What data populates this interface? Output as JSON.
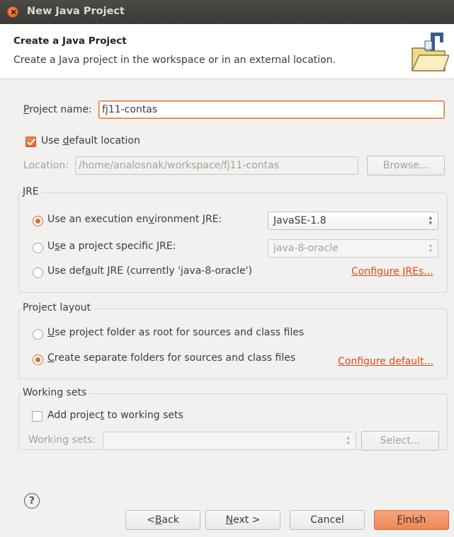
{
  "window": {
    "title": "New Java Project"
  },
  "header": {
    "title": "Create a Java Project",
    "description": "Create a Java project in the workspace or in an external location."
  },
  "project_name": {
    "label_prefix": "",
    "label_mnemonic": "P",
    "label_rest": "roject name:",
    "value": "fj11-contas"
  },
  "default_location": {
    "label_prefix": "Use ",
    "label_mnemonic": "d",
    "label_rest": "efault location",
    "checked": true
  },
  "location": {
    "label": "Location:",
    "value": "/home/analosnak/workspace/fj11-contas",
    "browse_label": "Browse..."
  },
  "jre": {
    "group_label": "JRE",
    "option1": {
      "label_prefix": "Use an execution en",
      "label_mnemonic": "v",
      "label_rest": "ironment JRE:",
      "selected": true,
      "combo_value": "JavaSE-1.8"
    },
    "option2": {
      "label_prefix": "U",
      "label_mnemonic": "s",
      "label_rest": "e a project specific JRE:",
      "selected": false,
      "combo_value": "java-8-oracle"
    },
    "option3": {
      "label_prefix": "Use def",
      "label_mnemonic": "a",
      "label_rest": "ult JRE (currently 'java-8-oracle')",
      "selected": false
    },
    "configure_link": "Configure JREs..."
  },
  "layout": {
    "group_label": "Project layout",
    "option1": {
      "label_prefix": "",
      "label_mnemonic": "U",
      "label_rest": "se project folder as root for sources and class files",
      "selected": false
    },
    "option2": {
      "label_prefix": "",
      "label_mnemonic": "C",
      "label_rest": "reate separate folders for sources and class files",
      "selected": true
    },
    "configure_link": "Configure default..."
  },
  "working_sets": {
    "group_label": "Working sets",
    "add_label_prefix": "Add projec",
    "add_label_mnemonic": "t",
    "add_label_rest": " to working sets",
    "checked": false,
    "field_label": "Working sets:",
    "select_label": "Select..."
  },
  "footer": {
    "help": "?",
    "back_prefix": "< ",
    "back_mnemonic": "B",
    "back_rest": "ack",
    "next_mnemonic": "N",
    "next_rest": "ext >",
    "cancel": "Cancel",
    "finish_mnemonic": "F",
    "finish_rest": "inish"
  },
  "colors": {
    "accent": "#e2692f",
    "link": "#dd4a14",
    "titlebar": "#3c3b37"
  }
}
